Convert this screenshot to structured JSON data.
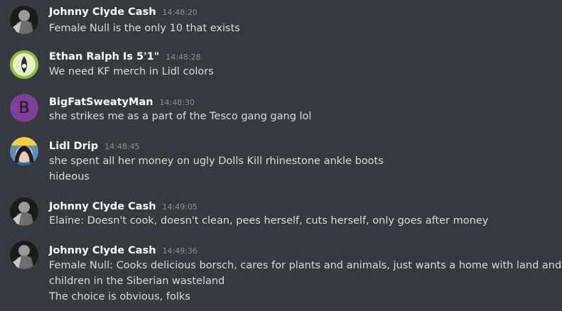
{
  "messages": [
    {
      "author": "Johnny Clyde Cash",
      "time": "14:48:20",
      "lines": [
        "Female Null is the only 10 that exists"
      ]
    },
    {
      "author": "Ethan Ralph Is 5'1\"",
      "time": "14:48:28",
      "lines": [
        "We need KF merch in Lidl colors"
      ]
    },
    {
      "author": "BigFatSweatyMan",
      "time": "14:48:30",
      "avatar_letter": "B",
      "lines": [
        "she strikes me as a part of the Tesco gang gang lol"
      ]
    },
    {
      "author": "Lidl Drip",
      "time": "14:48:45",
      "lines": [
        "she spent all her money on ugly Dolls Kill rhinestone ankle boots",
        "hideous"
      ]
    },
    {
      "author": "Johnny Clyde Cash",
      "time": "14:49:05",
      "lines": [
        "Elaine: Doesn't cook, doesn't clean, pees herself, cuts herself, only goes after money"
      ]
    },
    {
      "author": "Johnny Clyde Cash",
      "time": "14:49:36",
      "lines": [
        "Female Null: Cooks delicious borsch, cares for plants and animals, just wants a home with land and",
        "children in the Siberian wasteland",
        "The choice is obvious, folks"
      ]
    }
  ],
  "colors": {
    "background": "#36393f",
    "text": "#dcddde",
    "username": "#ffffff",
    "timestamp": "#8e9297",
    "avatar_purple": "#7d3f98"
  }
}
